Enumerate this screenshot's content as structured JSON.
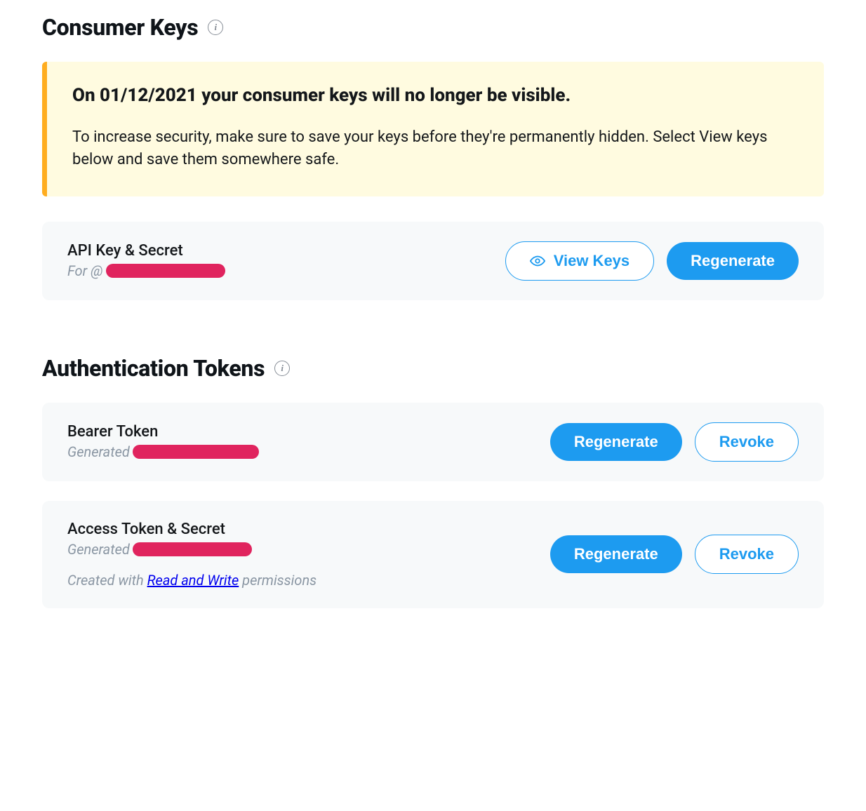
{
  "consumer_keys": {
    "title": "Consumer Keys",
    "alert": {
      "title": "On 01/12/2021 your consumer keys will no longer be visible.",
      "body": "To increase security, make sure to save your keys before they're permanently hidden. Select View keys below and save them somewhere safe."
    },
    "api_key_secret": {
      "title": "API Key & Secret",
      "for_prefix": "For @",
      "view_keys": "View Keys",
      "regenerate": "Regenerate"
    }
  },
  "auth_tokens": {
    "title": "Authentication Tokens",
    "bearer": {
      "title": "Bearer Token",
      "generated_prefix": "Generated",
      "regenerate": "Regenerate",
      "revoke": "Revoke"
    },
    "access": {
      "title": "Access Token & Secret",
      "generated_prefix": "Generated ",
      "regenerate": "Regenerate",
      "revoke": "Revoke",
      "perm_prefix": "Created with ",
      "perm_link": "Read and Write",
      "perm_suffix": " permissions"
    }
  }
}
